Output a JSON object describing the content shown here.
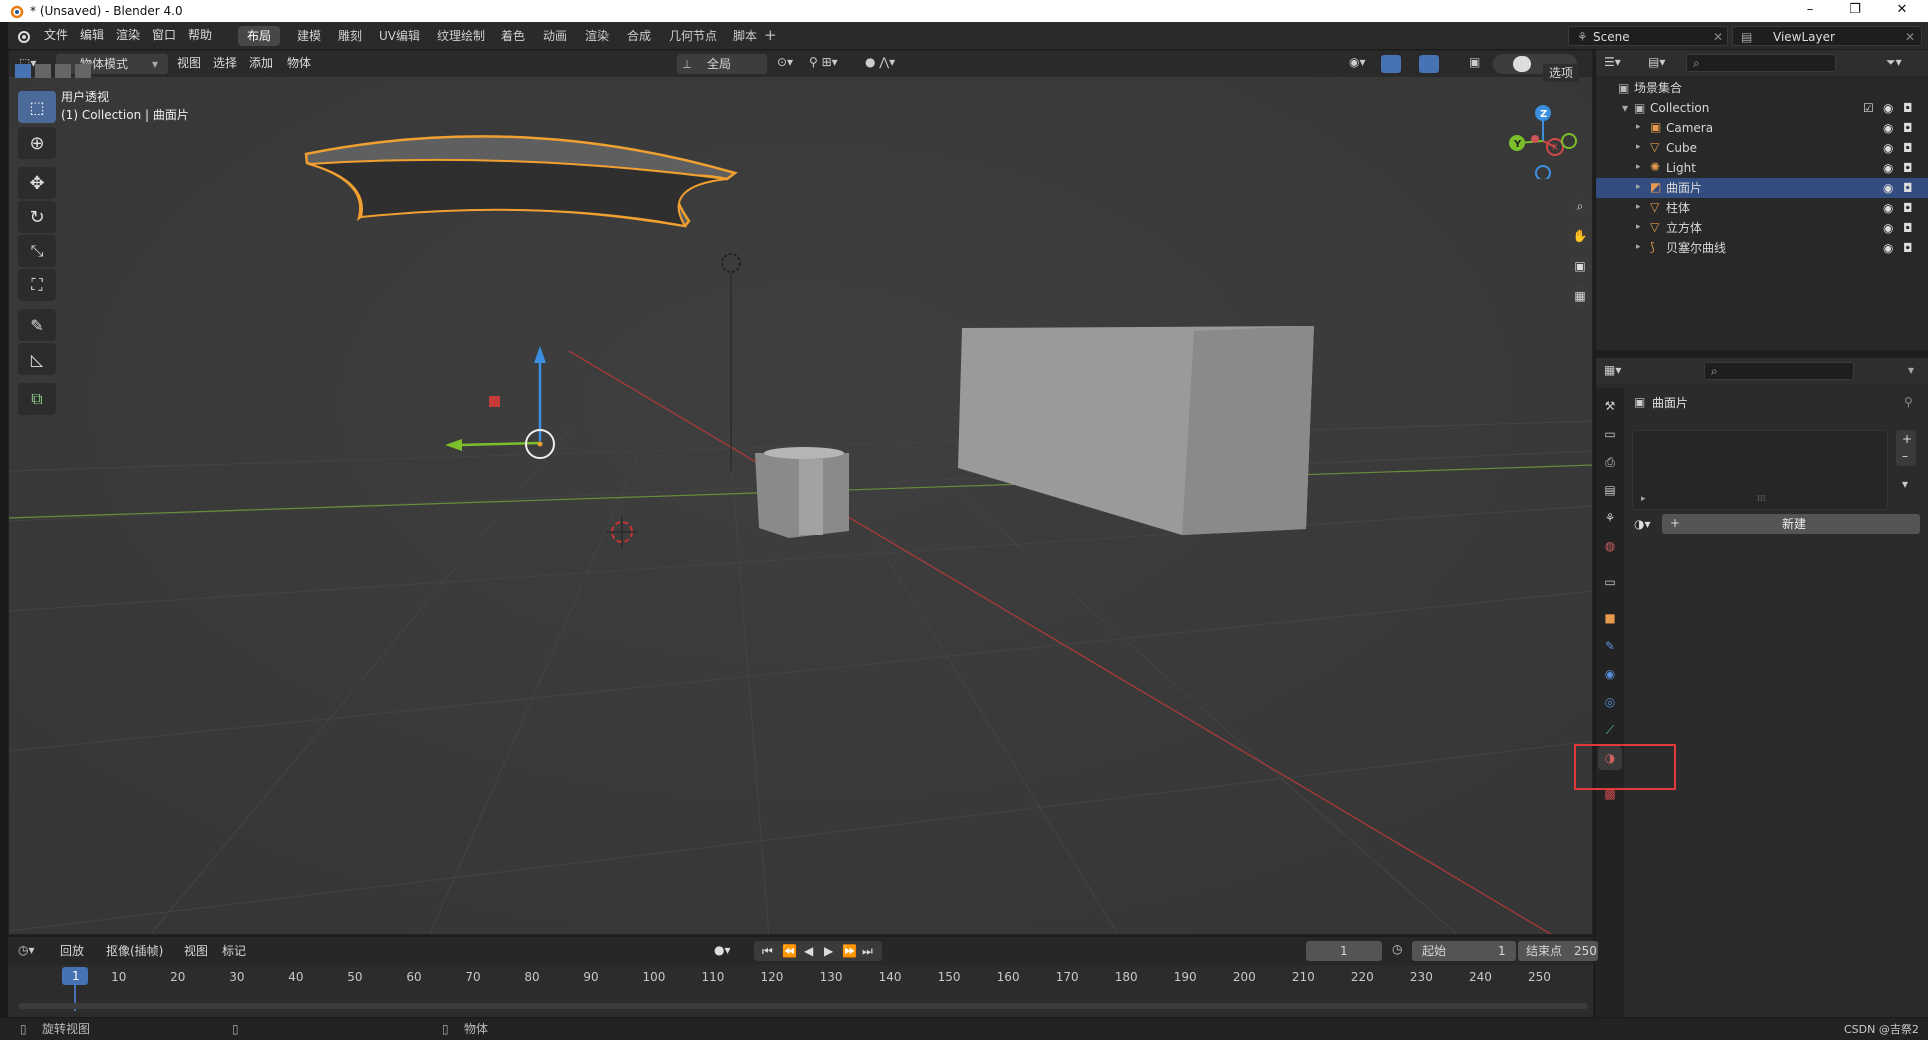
{
  "window": {
    "title": "* (Unsaved) - Blender 4.0",
    "controls": [
      "–",
      "❐",
      "✕"
    ]
  },
  "menu": [
    "文件",
    "编辑",
    "渲染",
    "窗口",
    "帮助"
  ],
  "workspaces": [
    "布局",
    "建模",
    "雕刻",
    "UV编辑",
    "纹理绘制",
    "着色",
    "动画",
    "渲染",
    "合成",
    "几何节点",
    "脚本"
  ],
  "active_workspace": "布局",
  "scene": {
    "name": "Scene",
    "view_layer": "ViewLayer"
  },
  "viewport": {
    "mode": "物体模式",
    "menus": [
      "视图",
      "选择",
      "添加",
      "物体"
    ],
    "transform_orientation": "全局",
    "options_label": "选项",
    "view_name": "用户透视",
    "collection_info": "(1) Collection | 曲面片",
    "gizmo_axes": [
      "Z",
      "Y",
      "X"
    ]
  },
  "outliner": {
    "root": "场景集合",
    "collection": "Collection",
    "items": [
      {
        "name": "Camera",
        "icon": "camera-icon",
        "color": "#e59a4d"
      },
      {
        "name": "Cube",
        "icon": "mesh-icon",
        "color": "#e59a4d"
      },
      {
        "name": "Light",
        "icon": "light-icon",
        "color": "#e59a4d"
      },
      {
        "name": "曲面片",
        "icon": "surface-icon",
        "color": "#e59a4d",
        "selected": true
      },
      {
        "name": "柱体",
        "icon": "mesh-icon",
        "color": "#e59a4d"
      },
      {
        "name": "立方体",
        "icon": "mesh-icon",
        "color": "#e59a4d"
      },
      {
        "name": "贝塞尔曲线",
        "icon": "curve-icon",
        "color": "#e59a4d"
      }
    ]
  },
  "properties": {
    "object_name": "曲面片",
    "new_button": "新建",
    "active_tab": "material-tab"
  },
  "timeline": {
    "menus": [
      "回放",
      "抠像(插帧)",
      "视图",
      "标记"
    ],
    "current_frame": "1",
    "start_label": "起始",
    "start_value": "1",
    "end_label": "结束点",
    "end_value": "250",
    "ticks": [
      "1",
      "10",
      "20",
      "30",
      "40",
      "50",
      "60",
      "70",
      "80",
      "90",
      "100",
      "110",
      "120",
      "130",
      "140",
      "150",
      "160",
      "170",
      "180",
      "190",
      "200",
      "210",
      "220",
      "230",
      "240",
      "250"
    ]
  },
  "status": {
    "left": "旋转视图",
    "middle": "物体",
    "right": "CSDN @吉祭2"
  },
  "colors": {
    "accent": "#4772b3",
    "selection_outline": "#f0a030",
    "highlight_box": "#e23a3a"
  }
}
